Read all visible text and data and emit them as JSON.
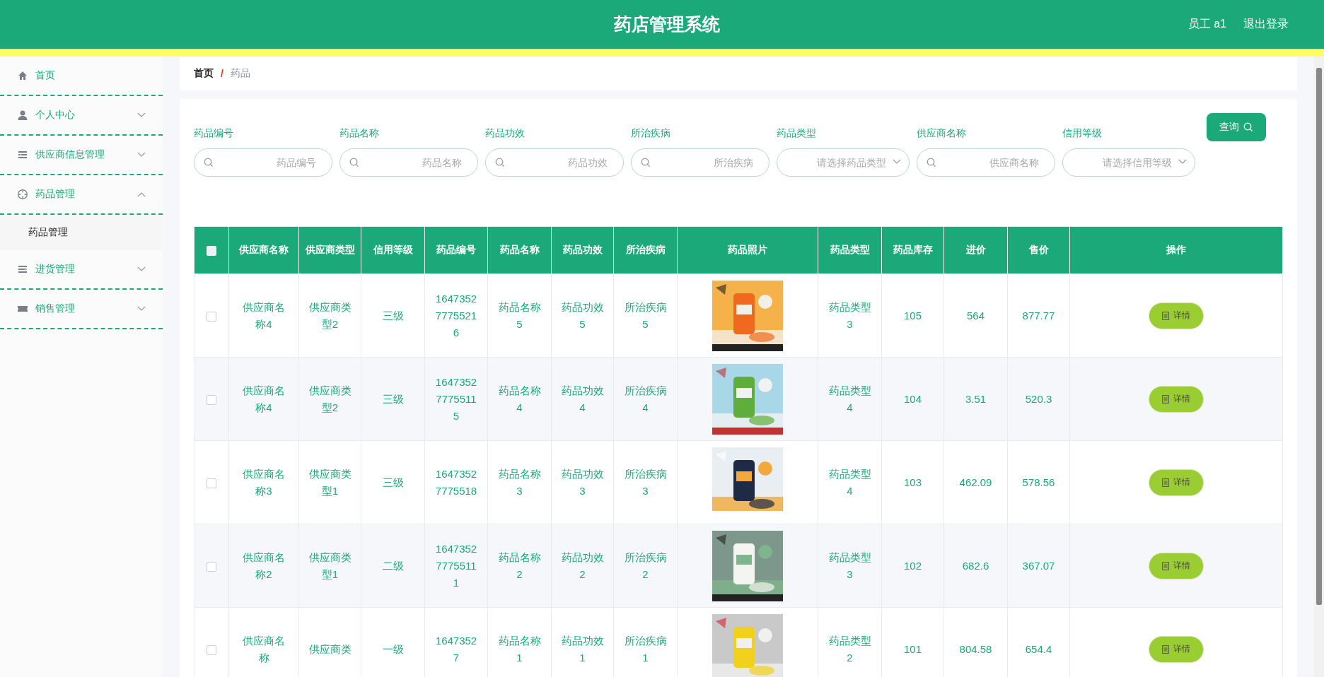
{
  "header": {
    "title": "药店管理系统",
    "user": "员工 a1",
    "logout": "退出登录"
  },
  "sidebar": {
    "items": [
      {
        "label": "首页"
      },
      {
        "label": "个人中心",
        "expanded": false
      },
      {
        "label": "供应商信息管理",
        "expanded": false
      },
      {
        "label": "药品管理",
        "expanded": true,
        "children": [
          {
            "label": "药品管理",
            "selected": true
          }
        ]
      },
      {
        "label": "进货管理",
        "expanded": false
      },
      {
        "label": "销售管理",
        "expanded": false
      }
    ]
  },
  "breadcrumb": {
    "home": "首页",
    "separator": "/",
    "current": "药品"
  },
  "search": {
    "fields": [
      {
        "kind": "text",
        "label": "药品编号",
        "placeholder": "药品编号"
      },
      {
        "kind": "text",
        "label": "药品名称",
        "placeholder": "药品名称"
      },
      {
        "kind": "text",
        "label": "药品功效",
        "placeholder": "药品功效"
      },
      {
        "kind": "text",
        "label": "所治疾病",
        "placeholder": "所治疾病"
      },
      {
        "kind": "select",
        "label": "药品类型",
        "placeholder": "请选择药品类型"
      },
      {
        "kind": "text",
        "label": "供应商名称",
        "placeholder": "供应商名称"
      },
      {
        "kind": "select",
        "label": "信用等级",
        "placeholder": "请选择信用等级"
      }
    ],
    "button": "查询"
  },
  "table": {
    "columns": [
      "供应商名称",
      "供应商类型",
      "信用等级",
      "药品编号",
      "药品名称",
      "药品功效",
      "所治疾病",
      "药品照片",
      "药品类型",
      "药品库存",
      "进价",
      "售价",
      "操作"
    ],
    "all_selected": false,
    "rows": [
      {
        "selected": false,
        "cells": [
          "供应商名称4",
          "供应商类型2",
          "三级",
          "164735277755216",
          "药品名称5",
          "药品功效5",
          "所治疾病5",
          {
            "kind": "picture"
          },
          "药品类型3",
          "105",
          "564",
          "877.77",
          "详情"
        ]
      },
      {
        "selected": false,
        "cells": [
          "供应商名称4",
          "供应商类型2",
          "三级",
          "164735277755115",
          "药品名称4",
          "药品功效4",
          "所治疾病4",
          {
            "kind": "picture"
          },
          "药品类型4",
          "104",
          "3.51",
          "520.3",
          "详情"
        ]
      },
      {
        "selected": false,
        "cells": [
          "供应商名称3",
          "供应商类型1",
          "三级",
          "16473527775518",
          "药品名称3",
          "药品功效3",
          "所治疾病3",
          {
            "kind": "picture"
          },
          "药品类型4",
          "103",
          "462.09",
          "578.56",
          "详情"
        ]
      },
      {
        "selected": false,
        "cells": [
          "供应商名称2",
          "供应商类型1",
          "二级",
          "164735277755111",
          "药品名称2",
          "药品功效2",
          "所治疾病2",
          {
            "kind": "picture"
          },
          "药品类型3",
          "102",
          "682.6",
          "367.07",
          "详情"
        ]
      },
      {
        "selected": false,
        "cells": [
          "供应商名称",
          "供应商类",
          "一级",
          "16473527",
          "药品名称1",
          "药品功效1",
          "所治疾病1",
          {
            "kind": "picture"
          },
          "药品类型2",
          "101",
          "804.58",
          "654.4",
          "详情"
        ]
      }
    ]
  }
}
